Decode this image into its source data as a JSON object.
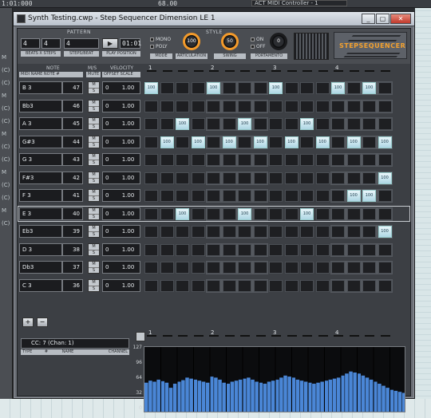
{
  "host": {
    "time": "1:01:000",
    "tempo": "68.00",
    "midi_controller": "ACT MIDI Controller - 1",
    "left_labels": [
      "M",
      "(C)",
      "(C)",
      "M",
      "(C)",
      "(C)",
      "M",
      "(C)",
      "(C)",
      "M",
      "(C)",
      "(C)",
      "M",
      "(C)"
    ]
  },
  "window": {
    "title": "Synth Testing.cwp - Step Sequencer Dimension LE 1",
    "btn_min": "_",
    "btn_max": "▢",
    "btn_close": "✕"
  },
  "pattern": {
    "label": "PATTERN",
    "beats": "4",
    "steps": "4",
    "steps_beat": "4",
    "play_position": "01:01",
    "sub_beats": "BEATS X STEPS",
    "sub_steps": "STEPS/BEAT",
    "sub_play": "PLAY POSITION",
    "play_icon": "▶"
  },
  "style": {
    "label": "STYLE",
    "mono": "MONO",
    "poly": "POLY",
    "mode_label": "MODE",
    "articulation_value": "100",
    "articulation_label": "ARTICULATION",
    "swing_value": "50",
    "swing_label": "SWING",
    "portamento_on": "ON",
    "portamento_off": "OFF",
    "portamento_value": "0",
    "portamento_label": "PORTAMENTO"
  },
  "logo": {
    "text": "STEPSEQUENCER"
  },
  "columns": {
    "note": "NOTE",
    "note_sub": "MIDI  NAME        NOTE #",
    "mute": "M/S",
    "mute_sub": "MUTE",
    "velocity": "VELOCITY",
    "velocity_sub": "OFFSET  SCALE"
  },
  "beats_header": [
    "1",
    "2",
    "3",
    "4"
  ],
  "rows": [
    {
      "name": "B 3",
      "num": "47",
      "mute": "M",
      "solo": "S",
      "vel_offset": "0",
      "vel_scale": "1.00",
      "steps": [
        1,
        0,
        0,
        0,
        1,
        0,
        0,
        0,
        1,
        0,
        0,
        0,
        1,
        0,
        1,
        0
      ]
    },
    {
      "name": "Bb3",
      "num": "46",
      "mute": "M",
      "solo": "S",
      "vel_offset": "0",
      "vel_scale": "1.00",
      "steps": [
        0,
        0,
        0,
        0,
        0,
        0,
        0,
        0,
        0,
        0,
        0,
        0,
        0,
        0,
        0,
        0
      ]
    },
    {
      "name": "A 3",
      "num": "45",
      "mute": "M",
      "solo": "S",
      "vel_offset": "0",
      "vel_scale": "1.00",
      "steps": [
        0,
        0,
        1,
        0,
        0,
        0,
        1,
        0,
        0,
        0,
        1,
        0,
        0,
        0,
        0,
        0
      ]
    },
    {
      "name": "G#3",
      "num": "44",
      "mute": "M",
      "solo": "S",
      "vel_offset": "0",
      "vel_scale": "1.00",
      "steps": [
        0,
        1,
        0,
        1,
        0,
        1,
        0,
        1,
        0,
        1,
        0,
        1,
        0,
        1,
        0,
        1
      ]
    },
    {
      "name": "G 3",
      "num": "43",
      "mute": "M",
      "solo": "S",
      "vel_offset": "0",
      "vel_scale": "1.00",
      "steps": [
        0,
        0,
        0,
        0,
        0,
        0,
        0,
        0,
        0,
        0,
        0,
        0,
        0,
        0,
        0,
        0
      ]
    },
    {
      "name": "F#3",
      "num": "42",
      "mute": "M",
      "solo": "S",
      "vel_offset": "0",
      "vel_scale": "1.00",
      "steps": [
        0,
        0,
        0,
        0,
        0,
        0,
        0,
        0,
        0,
        0,
        0,
        0,
        0,
        0,
        0,
        1
      ]
    },
    {
      "name": "F 3",
      "num": "41",
      "mute": "M",
      "solo": "S",
      "vel_offset": "0",
      "vel_scale": "1.00",
      "steps": [
        0,
        0,
        0,
        0,
        0,
        0,
        0,
        0,
        0,
        0,
        0,
        0,
        0,
        1,
        1,
        0
      ]
    },
    {
      "name": "E 3",
      "num": "40",
      "mute": "M",
      "solo": "S",
      "vel_offset": "0",
      "vel_scale": "1.00",
      "steps": [
        0,
        0,
        1,
        0,
        0,
        0,
        1,
        0,
        0,
        0,
        1,
        0,
        0,
        0,
        0,
        0
      ],
      "selected": true
    },
    {
      "name": "Eb3",
      "num": "39",
      "mute": "M",
      "solo": "S",
      "vel_offset": "0",
      "vel_scale": "1.00",
      "steps": [
        0,
        0,
        0,
        0,
        0,
        0,
        0,
        0,
        0,
        0,
        0,
        0,
        0,
        0,
        0,
        1
      ]
    },
    {
      "name": "D 3",
      "num": "38",
      "mute": "M",
      "solo": "S",
      "vel_offset": "0",
      "vel_scale": "1.00",
      "steps": [
        0,
        0,
        0,
        0,
        0,
        0,
        0,
        0,
        0,
        0,
        0,
        0,
        0,
        0,
        0,
        0
      ]
    },
    {
      "name": "Db3",
      "num": "37",
      "mute": "M",
      "solo": "S",
      "vel_offset": "0",
      "vel_scale": "1.00",
      "steps": [
        0,
        0,
        0,
        0,
        0,
        0,
        0,
        0,
        0,
        0,
        0,
        0,
        0,
        0,
        0,
        0
      ]
    },
    {
      "name": "C 3",
      "num": "36",
      "mute": "M",
      "solo": "S",
      "vel_offset": "0",
      "vel_scale": "1.00",
      "steps": [
        0,
        0,
        0,
        0,
        0,
        0,
        0,
        0,
        0,
        0,
        0,
        0,
        0,
        0,
        0,
        0
      ]
    }
  ],
  "step_value": "100",
  "cc": {
    "add": "+",
    "remove": "−",
    "selector": "CC: 7 (Chan: 1)",
    "sub_type": "TYPE",
    "sub_num": "#",
    "sub_name": "NAME",
    "sub_channel": "CHANNEL",
    "y_labels": [
      "127",
      "96",
      "64",
      "32",
      "0"
    ],
    "bar_color": "#4a86d6",
    "values": [
      60,
      64,
      62,
      66,
      63,
      60,
      50,
      58,
      62,
      65,
      70,
      68,
      66,
      64,
      62,
      60,
      72,
      70,
      66,
      60,
      58,
      62,
      64,
      66,
      68,
      70,
      66,
      62,
      60,
      58,
      62,
      64,
      66,
      70,
      74,
      72,
      70,
      66,
      64,
      62,
      60,
      58,
      60,
      62,
      64,
      66,
      68,
      70,
      74,
      78,
      82,
      80,
      78,
      74,
      70,
      66,
      62,
      58,
      54,
      50,
      46,
      44,
      42,
      40
    ]
  }
}
